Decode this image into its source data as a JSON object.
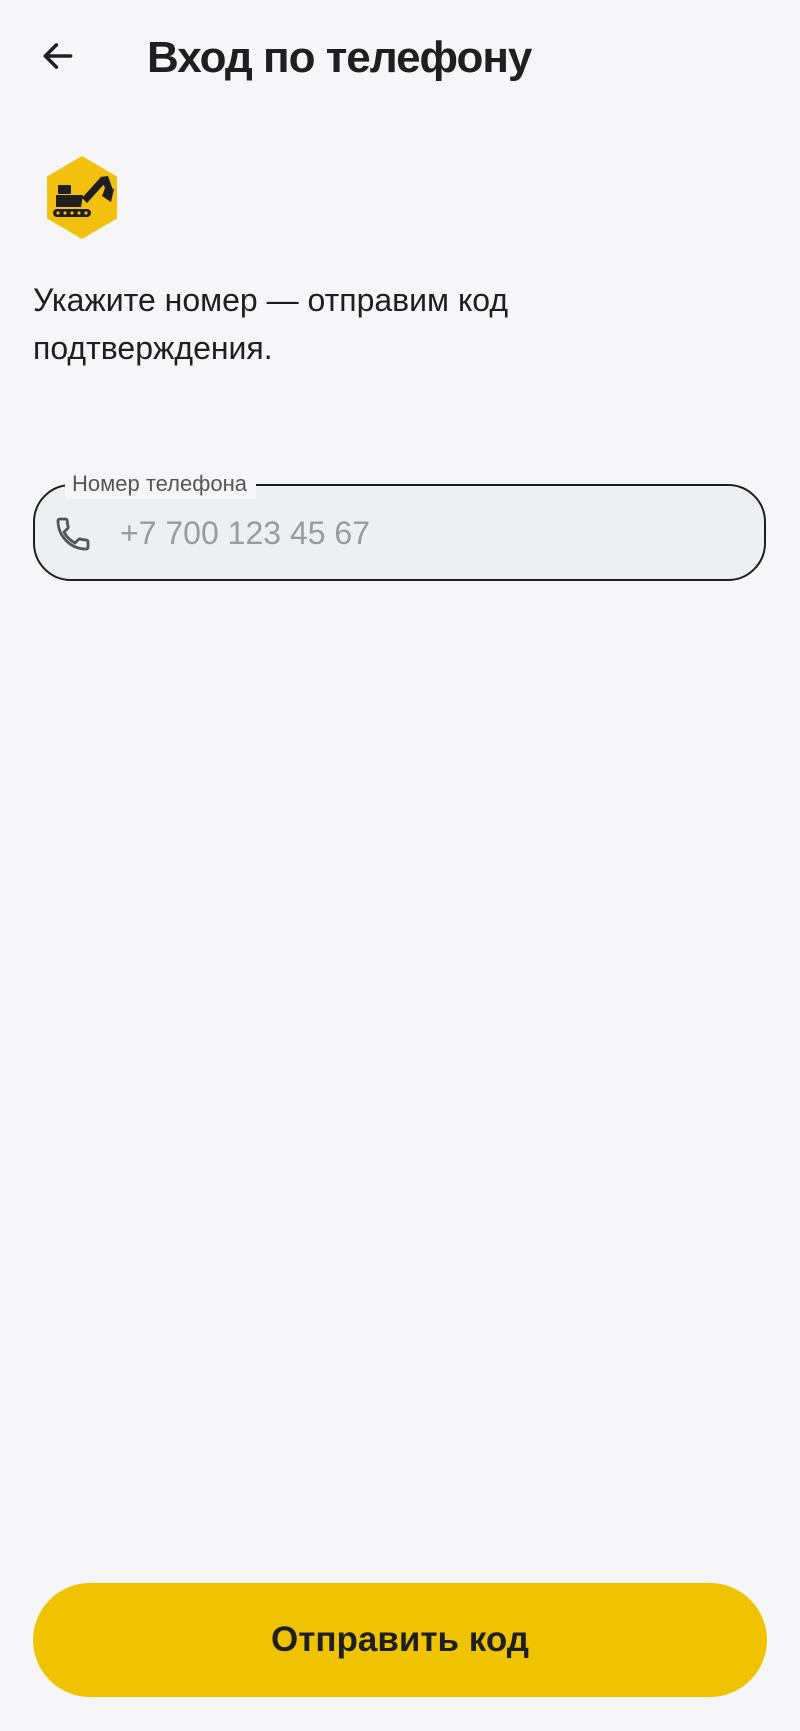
{
  "header": {
    "title": "Вход по телефону",
    "back_icon": "arrow-left-icon"
  },
  "logo": {
    "icon": "excavator-icon",
    "badge_color": "#F2C10F",
    "figure_color": "#1F1F1F"
  },
  "instruction": {
    "text": "Укажите номер — отправим код подтверждения."
  },
  "phone_field": {
    "label": "Номер телефона",
    "placeholder": "+7 700 123 45 67",
    "value": "",
    "icon": "phone-icon"
  },
  "actions": {
    "send_code_label": "Отправить код"
  },
  "colors": {
    "background": "#F6F6F8",
    "accent": "#EFC300",
    "text": "#1F1F1F",
    "field_background": "#EEEFF1",
    "placeholder": "#9B9B9D"
  }
}
